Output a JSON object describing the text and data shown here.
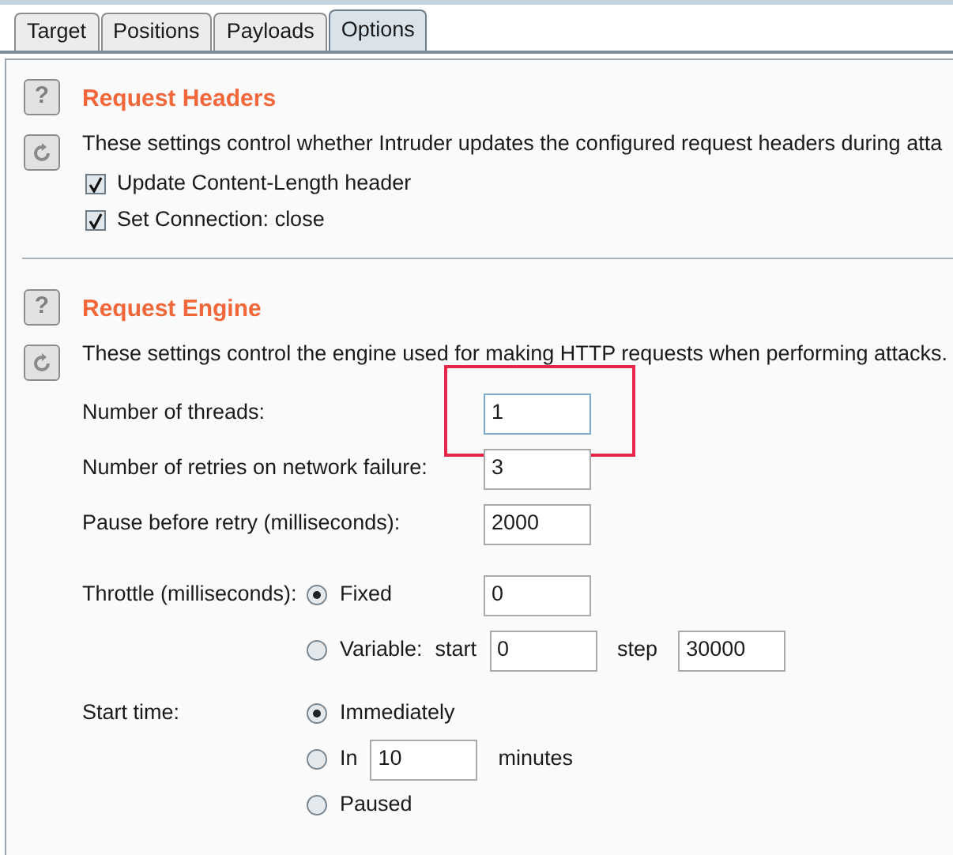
{
  "tabs": [
    {
      "label": "Target",
      "selected": false
    },
    {
      "label": "Positions",
      "selected": false
    },
    {
      "label": "Payloads",
      "selected": false
    },
    {
      "label": "Options",
      "selected": true
    }
  ],
  "sections": [
    {
      "help_glyph": "?",
      "title": "Request Headers",
      "description": "These settings control whether Intruder updates the configured request headers during atta",
      "rows": [
        {
          "kind": "checkbox",
          "label": "Update Content-Length header",
          "checked": true
        },
        {
          "kind": "checkbox",
          "label": "Set Connection: close",
          "checked": true
        }
      ]
    },
    {
      "help_glyph": "?",
      "title": "Request Engine",
      "description": "These settings control the engine used for making HTTP requests when performing attacks.",
      "rows": [
        {
          "kind": "field",
          "label": "Number of threads:",
          "value": "1",
          "highlighted": true
        },
        {
          "kind": "field",
          "label": "Number of retries on network failure:",
          "value": "3",
          "highlighted": false
        },
        {
          "kind": "field",
          "label": "Pause before retry (milliseconds):",
          "value": "2000",
          "highlighted": false
        },
        {
          "kind": "radio_grid",
          "label": "Throttle (milliseconds):",
          "options": [
            {
              "label": "Fixed",
              "selected": true,
              "parts": [
                {
                  "kind": "field",
                  "value": "0"
                }
              ]
            },
            {
              "label": "Variable:",
              "selected": false,
              "parts": [
                {
                  "kind": "text",
                  "text": "start"
                },
                {
                  "kind": "field",
                  "value": "0"
                },
                {
                  "kind": "text",
                  "text": "step"
                },
                {
                  "kind": "field",
                  "value": "30000"
                }
              ]
            }
          ]
        },
        {
          "kind": "radio_list",
          "label": "Start time:",
          "options": [
            {
              "label": "Immediately",
              "selected": true
            },
            {
              "label": "In",
              "selected": false,
              "parts": [
                {
                  "kind": "field",
                  "value": "10"
                },
                {
                  "kind": "text",
                  "text": "minutes"
                }
              ]
            },
            {
              "label": "Paused",
              "selected": false
            }
          ]
        }
      ]
    }
  ]
}
